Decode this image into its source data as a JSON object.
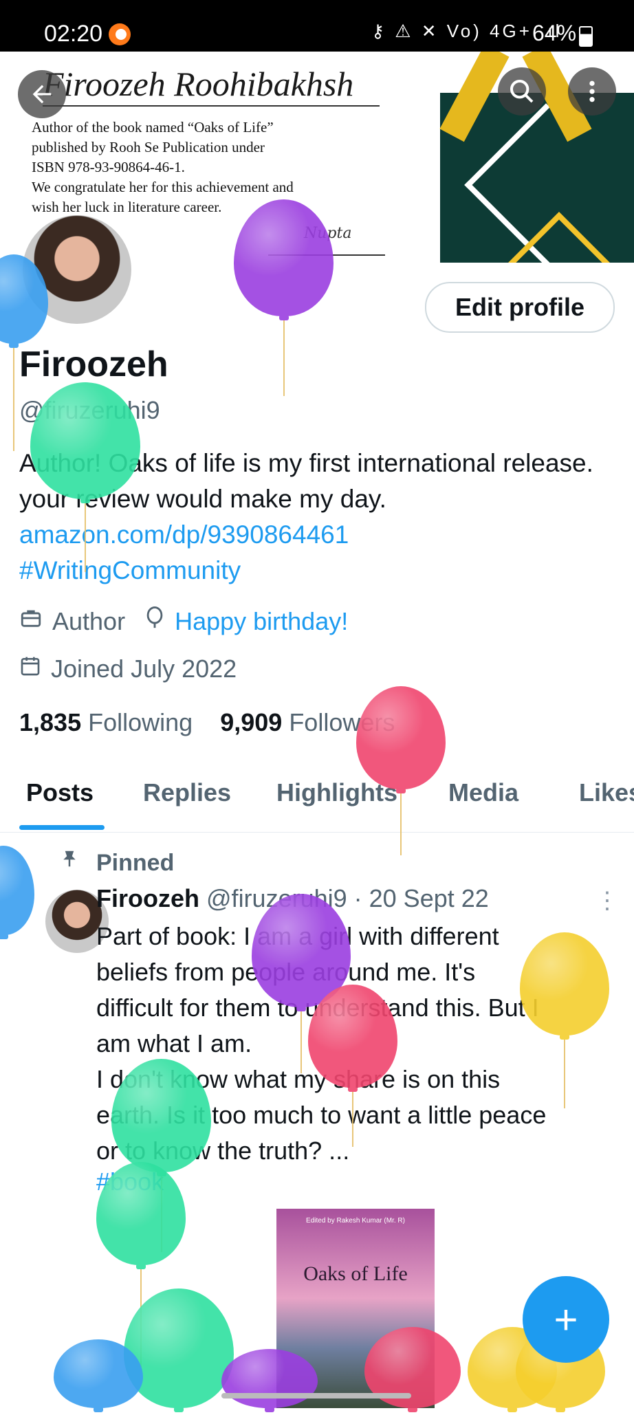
{
  "status_bar": {
    "time": "02:20",
    "system_icons": "⚷ ⚠ ✕ Vo) 4G+ .ıl",
    "battery": "64%"
  },
  "banner": {
    "name": "Firoozeh Roohibakhsh",
    "body": "Author of the book named “Oaks of Life”\npublished by Rooh Se Publication under\n ISBN 978-93-90864-46-1.\nWe congratulate her for this achievement and\nwish her luck in literature career.",
    "signature": "Nupta"
  },
  "header": {
    "back_icon": "arrow-left-icon",
    "search_icon": "search-icon",
    "more_icon": "more-vertical-icon"
  },
  "profile": {
    "edit_label": "Edit profile",
    "display_name": "Firoozeh",
    "handle": "@firuzeruhi9",
    "bio_text": "Author!  Oaks of life is my first international release. your review would make my day. ",
    "bio_link": "amazon.com/dp/9390864461",
    "bio_hashtag": "#WritingCommunity",
    "profession": "Author",
    "birthday": "Happy birthday!",
    "joined": "Joined July 2022",
    "following_count": "1,835",
    "following_label": "Following",
    "followers_count": "9,909",
    "followers_label": "Followers"
  },
  "tabs": [
    "Posts",
    "Replies",
    "Highlights",
    "Media",
    "Likes"
  ],
  "post": {
    "pinned_label": "Pinned",
    "author": "Firoozeh",
    "handle_date": "@firuzeruhi9 · 20 Sept 22",
    "text": "Part of book: I am a girl with different\nbeliefs from people around me. It's\ndifficult for them to understand this. But I\nam what I am.\nI don't know what my share is on this\nearth. Is it too much to want a little peace\nor to know the truth? ...",
    "hashtag": "#book",
    "book_editor": "Edited by Rakesh Kumar (Mr. R)",
    "book_title": "Oaks of Life"
  },
  "fab_label": "+",
  "colors": {
    "accent": "#1d9bf0",
    "text_primary": "#0f1419",
    "text_secondary": "#536471",
    "balloon_purple": "#9b3fe0",
    "balloon_green": "#2fe0a0",
    "balloon_blue": "#3a9ff0",
    "balloon_red": "#f0456e",
    "balloon_yellow": "#f5cf2e"
  }
}
